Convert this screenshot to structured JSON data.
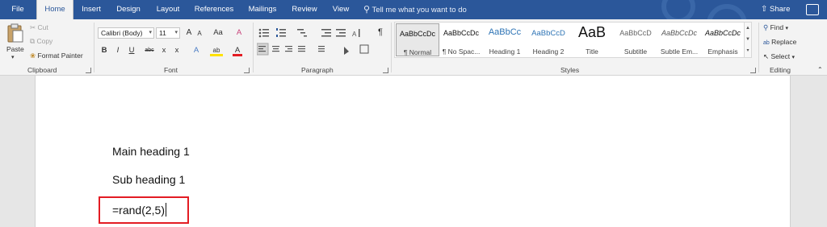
{
  "tabs": [
    {
      "label": "File",
      "active": false
    },
    {
      "label": "Home",
      "active": true
    },
    {
      "label": "Insert",
      "active": false
    },
    {
      "label": "Design",
      "active": false
    },
    {
      "label": "Layout",
      "active": false
    },
    {
      "label": "References",
      "active": false
    },
    {
      "label": "Mailings",
      "active": false
    },
    {
      "label": "Review",
      "active": false
    },
    {
      "label": "View",
      "active": false
    }
  ],
  "tell_me": "Tell me what you want to do",
  "share": "Share",
  "colors": {
    "accent": "#2b579a",
    "ribbon": "#f3f3f3",
    "highlight": "#e31c23"
  },
  "clipboard": {
    "paste": "Paste",
    "cut": "Cut",
    "copy": "Copy",
    "format_painter": "Format Painter",
    "label": "Clipboard"
  },
  "font": {
    "name": "Calibri (Body)",
    "size": "11",
    "label": "Font",
    "buttons": {
      "grow": "A",
      "shrink": "A",
      "case": "Aa",
      "clear": "A",
      "bold": "B",
      "italic": "I",
      "underline": "U",
      "strike": "abc",
      "sub": "x",
      "sup": "x",
      "effects": "A",
      "highlight": "ab",
      "color": "A"
    }
  },
  "paragraph": {
    "label": "Paragraph",
    "pilcrow": "¶"
  },
  "styles": {
    "label": "Styles",
    "items": [
      {
        "preview": "AaBbCcDc",
        "name": "¶ Normal",
        "selected": true
      },
      {
        "preview": "AaBbCcDc",
        "name": "¶ No Spac...",
        "selected": false
      },
      {
        "preview": "AaBbCc",
        "name": "Heading 1",
        "selected": false
      },
      {
        "preview": "AaBbCcD",
        "name": "Heading 2",
        "selected": false
      },
      {
        "preview": "AaB",
        "name": "Title",
        "selected": false
      },
      {
        "preview": "AaBbCcD",
        "name": "Subtitle",
        "selected": false
      },
      {
        "preview": "AaBbCcDc",
        "name": "Subtle Em...",
        "selected": false
      },
      {
        "preview": "AaBbCcDc",
        "name": "Emphasis",
        "selected": false
      }
    ]
  },
  "editing": {
    "find": "Find",
    "replace": "Replace",
    "select": "Select",
    "label": "Editing"
  },
  "document": {
    "lines": [
      "Main heading 1",
      "Sub heading 1",
      "=rand(2,5)"
    ]
  }
}
